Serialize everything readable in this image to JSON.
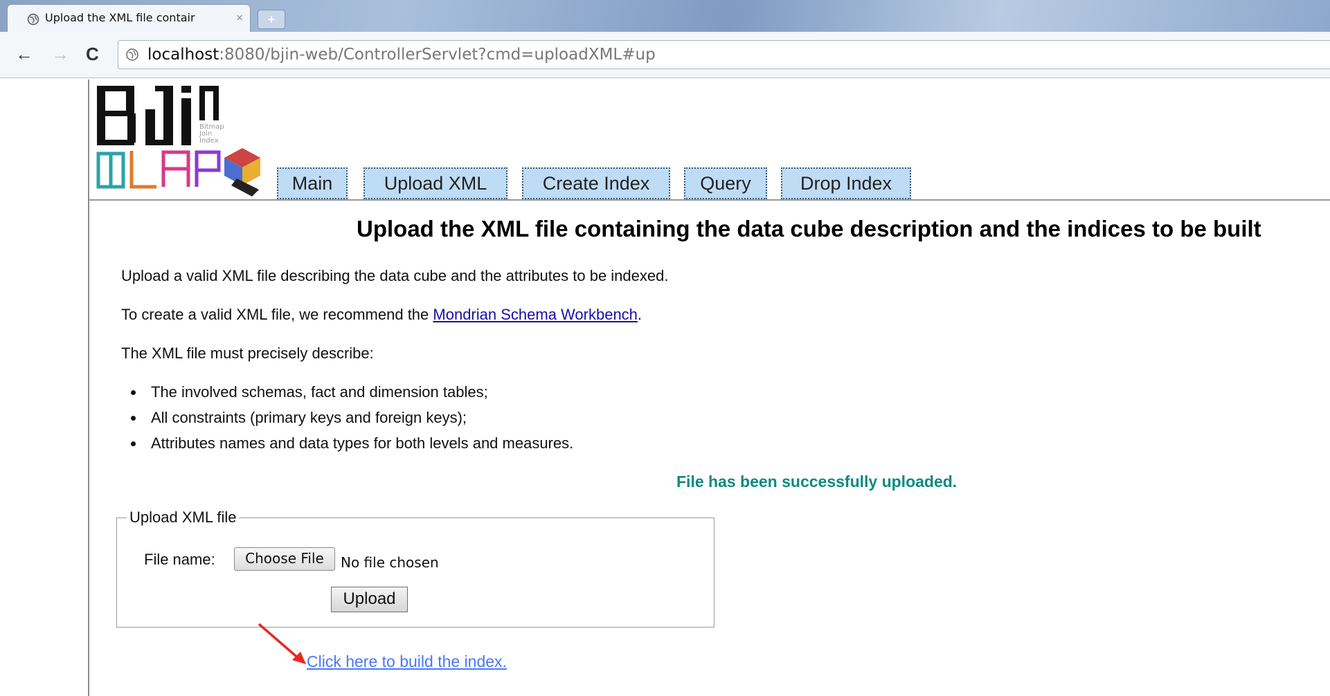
{
  "browser": {
    "tab_title": "Upload the XML file contair",
    "tab_close": "×",
    "new_tab": "+",
    "url_host": "localhost",
    "url_rest": ":8080/bjin-web/ControllerServlet?cmd=uploadXML#up",
    "back": "←",
    "forward": "→",
    "reload": "C"
  },
  "nav": {
    "items": [
      {
        "label": "Main"
      },
      {
        "label": "Upload XML"
      },
      {
        "label": "Create Index"
      },
      {
        "label": "Query"
      },
      {
        "label": "Drop Index"
      }
    ]
  },
  "logo": {
    "text1": "Bitmap",
    "text2": "Join",
    "text3": "Index"
  },
  "main": {
    "heading": "Upload the XML file containing the data cube description and the indices to be built",
    "intro": "Upload a valid XML file describing the data cube and the attributes to be indexed.",
    "recommend_prefix": "To create a valid XML file, we recommend the ",
    "recommend_link": "Mondrian Schema Workbench",
    "recommend_suffix": ".",
    "must_describe": "The XML file must precisely describe:",
    "bullets": [
      "The involved schemas, fact and dimension tables;",
      "All constraints (primary keys and foreign keys);",
      "Attributes names and data types for both levels and measures."
    ],
    "success": "File has been successfully uploaded."
  },
  "form": {
    "legend": "Upload XML file",
    "file_label": "File name:",
    "choose_button": "Choose File",
    "no_file": "No file chosen",
    "upload_button": "Upload"
  },
  "build_link": "Click here to build the index."
}
